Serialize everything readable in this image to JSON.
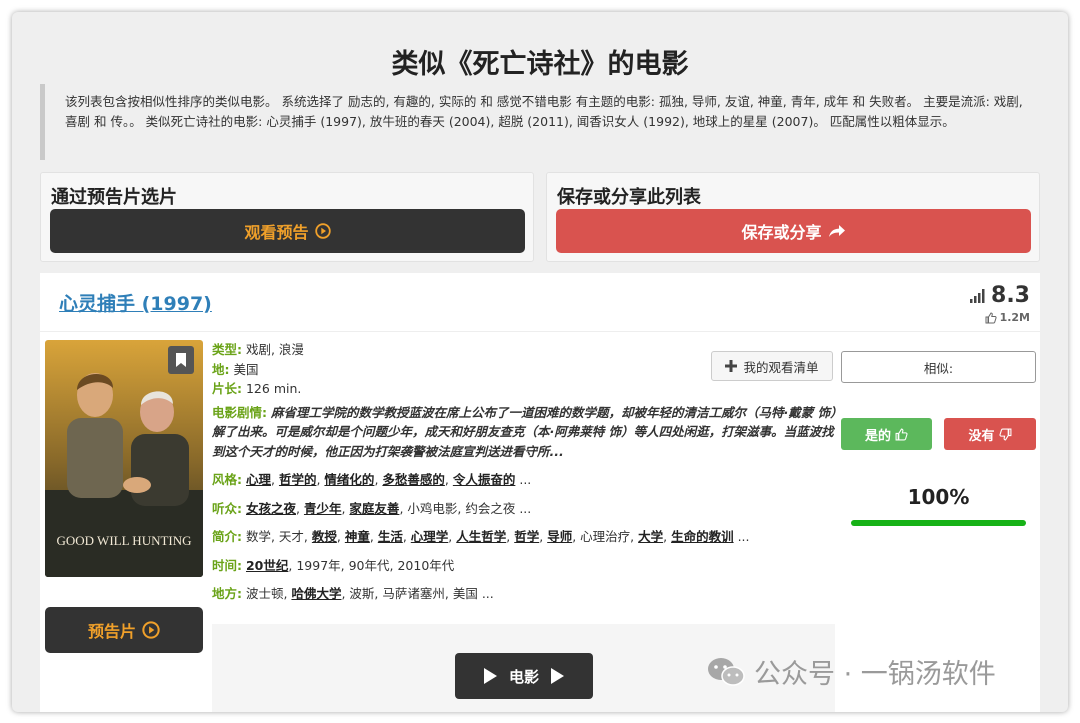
{
  "page": {
    "title": "类似《死亡诗社》的电影",
    "description": "该列表包含按相似性排序的类似电影。 系统选择了 励志的, 有趣的, 实际的 和 感觉不错电影 有主题的电影: 孤独, 导师, 友谊, 神童, 青年, 成年 和 失败者。 主要是流派: 戏剧, 喜剧 和 传。。 类似死亡诗社的电影: 心灵捕手 (1997), 放牛班的春天 (2004), 超脱 (2011), 闻香识女人 (1992), 地球上的星星 (2007)。 匹配属性以粗体显示。"
  },
  "panels": {
    "trailer_title": "通过预告片选片",
    "trailer_button": "观看预告",
    "share_title": "保存或分享此列表",
    "share_button": "保存或分享"
  },
  "movie": {
    "title": "心灵捕手 (1997)",
    "rating": "8.3",
    "votes": "1.2M",
    "poster_title": "GOOD WILL HUNTING",
    "genre_label": "类型:",
    "genre": "戏剧, 浪漫",
    "country_label": "地:",
    "country": "美国",
    "length_label": "片长:",
    "length": "126 min.",
    "plot_label": "电影剧情:",
    "plot": "麻省理工学院的数学教授蓝波在席上公布了一道困难的数学题，却被年轻的清洁工威尔（马特·戴蒙 饰）解了出来。可是威尔却是个问题少年，成天和好朋友查克（本·阿弗莱特 饰）等人四处闲逛，打架滋事。当蓝波找到这个天才的时候，他正因为打架袭警被法庭宣判送进看守所...",
    "style_label": "风格:",
    "style_tags": [
      "心理",
      "哲学的",
      "情绪化的",
      "多愁善感的",
      "令人振奋的"
    ],
    "audience_label": "听众:",
    "audience_tags": [
      "女孩之夜",
      "青少年",
      "家庭友善"
    ],
    "audience_rest": "小鸡电影, 约会之夜",
    "plot_keywords_label": "简介:",
    "time_label": "时间:",
    "time_bold": "20世纪",
    "time_rest": "1997年, 90年代, 2010年代",
    "place_label": "地方:",
    "place_first": "波士顿",
    "place_bold": "哈佛大学",
    "place_rest": "波斯, 马萨诸塞州, 美国",
    "ellipsis": "...",
    "trailer_button": "预告片",
    "movie_button": "电影"
  },
  "actions": {
    "watchlist": "我的观看清单",
    "similar": "相似:",
    "yes": "是的",
    "no": "没有",
    "percent": "100%",
    "percent_value": 1.0
  },
  "watermark": {
    "text": "公众号 · 一锅汤软件"
  },
  "colors": {
    "accent_green": "#6aa318",
    "orange": "#f0a02a",
    "red": "#d9534f",
    "link_blue": "#2f7fb8",
    "bar_green": "#17b217"
  }
}
